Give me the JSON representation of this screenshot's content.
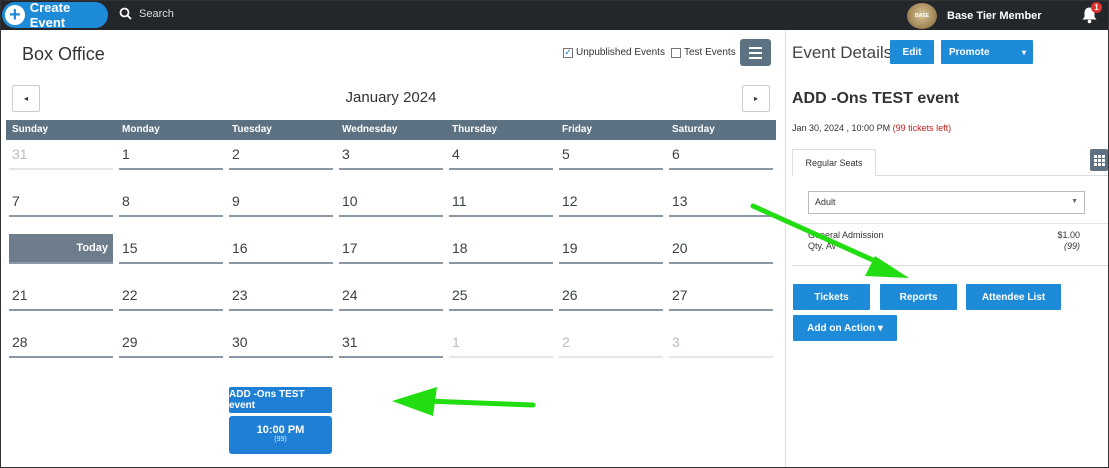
{
  "topbar": {
    "create_label": "Create Event",
    "search_label": "Search",
    "member_label": "Base Tier Member",
    "avatar_text": "BASE",
    "notification_count": "1"
  },
  "calendar": {
    "title": "Box Office",
    "filters": [
      {
        "label": "Unpublished Events",
        "checked": true
      },
      {
        "label": "Test Events",
        "checked": false
      }
    ],
    "prev_label": "◂",
    "next_label": "▸",
    "month_label": "January 2024",
    "weekdays": [
      "Sunday",
      "Monday",
      "Tuesday",
      "Wednesday",
      "Thursday",
      "Friday",
      "Saturday"
    ],
    "weeks": [
      [
        "31",
        "1",
        "2",
        "3",
        "4",
        "5",
        "6"
      ],
      [
        "7",
        "8",
        "9",
        "10",
        "11",
        "12",
        "13"
      ],
      [
        "Today",
        "15",
        "16",
        "17",
        "18",
        "19",
        "20"
      ],
      [
        "21",
        "22",
        "23",
        "24",
        "25",
        "26",
        "27"
      ],
      [
        "28",
        "29",
        "30",
        "31",
        "1",
        "2",
        "3"
      ]
    ],
    "event": {
      "title": "ADD -Ons TEST event",
      "time": "10:00 PM",
      "count": "(99)"
    }
  },
  "details": {
    "header": "Event Details",
    "edit_label": "Edit",
    "promote_label": "Promote",
    "event_name": "ADD -Ons TEST event",
    "date_text": "Jan 30, 2024 , 10:00 PM",
    "tickets_left": "(99 tickets left)",
    "tab_label": "Regular Seats",
    "select_value": "Adult",
    "ticket_type": "General Admission",
    "ticket_price": "$1.00",
    "qty_label": "Qty. Av",
    "qty_value": "(99)",
    "buttons": {
      "tickets": "Tickets",
      "reports": "Reports",
      "attendee": "Attendee List",
      "add_action": "Add on Action ▾"
    }
  },
  "colors": {
    "primary": "#1e8bd8",
    "topbar": "#23272b",
    "header_slate": "#5c7182",
    "arrow": "#22dd11",
    "alert": "#c0201b"
  }
}
